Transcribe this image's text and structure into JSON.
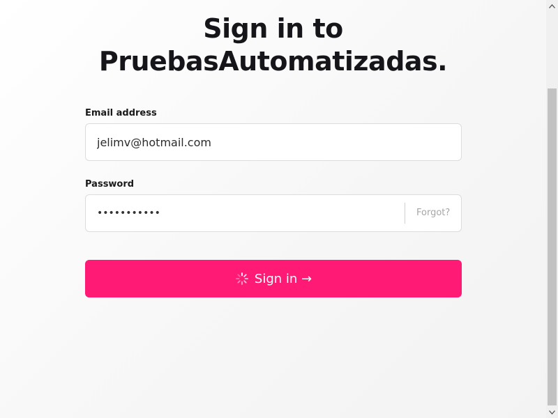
{
  "header": {
    "title_line1": "Sign in to",
    "title_line2": "PruebasAutomatizadas."
  },
  "form": {
    "email_label": "Email address",
    "email_value": "jelimv@hotmail.com",
    "password_label": "Password",
    "password_mask": "•••••••••••",
    "forgot_label": "Forgot?",
    "submit_label": "Sign in →"
  },
  "colors": {
    "accent": "#ff1a75",
    "text": "#16161a",
    "forgot": "#a6a6a6"
  },
  "icons": {
    "spinner": "loading-spinner-icon",
    "arrow": "right-arrow"
  }
}
